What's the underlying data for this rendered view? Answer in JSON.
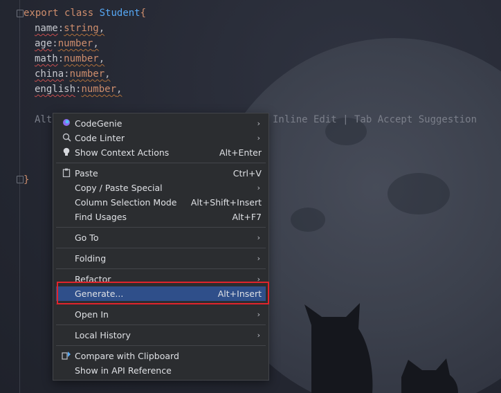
{
  "code": {
    "line1": {
      "kw1": "export",
      "kw2": "class",
      "name": "Student",
      "brace": "{"
    },
    "fields": [
      {
        "name": "name",
        "type": "string"
      },
      {
        "name": "age",
        "type": "number"
      },
      {
        "name": "math",
        "type": "number"
      },
      {
        "name": "china",
        "type": "number"
      },
      {
        "name": "english",
        "type": "number"
      }
    ],
    "colon": ":",
    "comma": ",",
    "hint_left": "Alt",
    "hint_right": "Inline Edit | Tab Accept Suggestion",
    "close_brace": "}"
  },
  "menu": {
    "items": [
      {
        "label": "CodeGenie",
        "shortcut": "",
        "submenu": true,
        "icon": "codegenie-icon"
      },
      {
        "label": "Code Linter",
        "shortcut": "",
        "submenu": true,
        "icon": "code-linter-icon"
      },
      {
        "label": "Show Context Actions",
        "shortcut": "Alt+Enter",
        "submenu": false,
        "icon": "lightbulb-icon"
      },
      {
        "label": "Paste",
        "shortcut": "Ctrl+V",
        "submenu": false,
        "icon": "clipboard-icon"
      },
      {
        "label": "Copy / Paste Special",
        "shortcut": "",
        "submenu": true,
        "icon": ""
      },
      {
        "label": "Column Selection Mode",
        "shortcut": "Alt+Shift+Insert",
        "submenu": false,
        "icon": ""
      },
      {
        "label": "Find Usages",
        "shortcut": "Alt+F7",
        "submenu": false,
        "icon": ""
      },
      {
        "label": "Go To",
        "shortcut": "",
        "submenu": true,
        "icon": ""
      },
      {
        "label": "Folding",
        "shortcut": "",
        "submenu": true,
        "icon": ""
      },
      {
        "label": "Refactor",
        "shortcut": "",
        "submenu": true,
        "icon": ""
      },
      {
        "label": "Generate...",
        "shortcut": "Alt+Insert",
        "submenu": false,
        "icon": "",
        "selected": true
      },
      {
        "label": "Open In",
        "shortcut": "",
        "submenu": true,
        "icon": ""
      },
      {
        "label": "Local History",
        "shortcut": "",
        "submenu": true,
        "icon": ""
      },
      {
        "label": "Compare with Clipboard",
        "shortcut": "",
        "submenu": false,
        "icon": "compare-icon"
      },
      {
        "label": "Show in API Reference",
        "shortcut": "",
        "submenu": false,
        "icon": ""
      }
    ],
    "arrow": "›"
  },
  "colors": {
    "selection": "#2f4f8a",
    "highlight_border": "#e0242c",
    "keyword": "#cf8e6d",
    "class_name": "#56a8f5"
  }
}
